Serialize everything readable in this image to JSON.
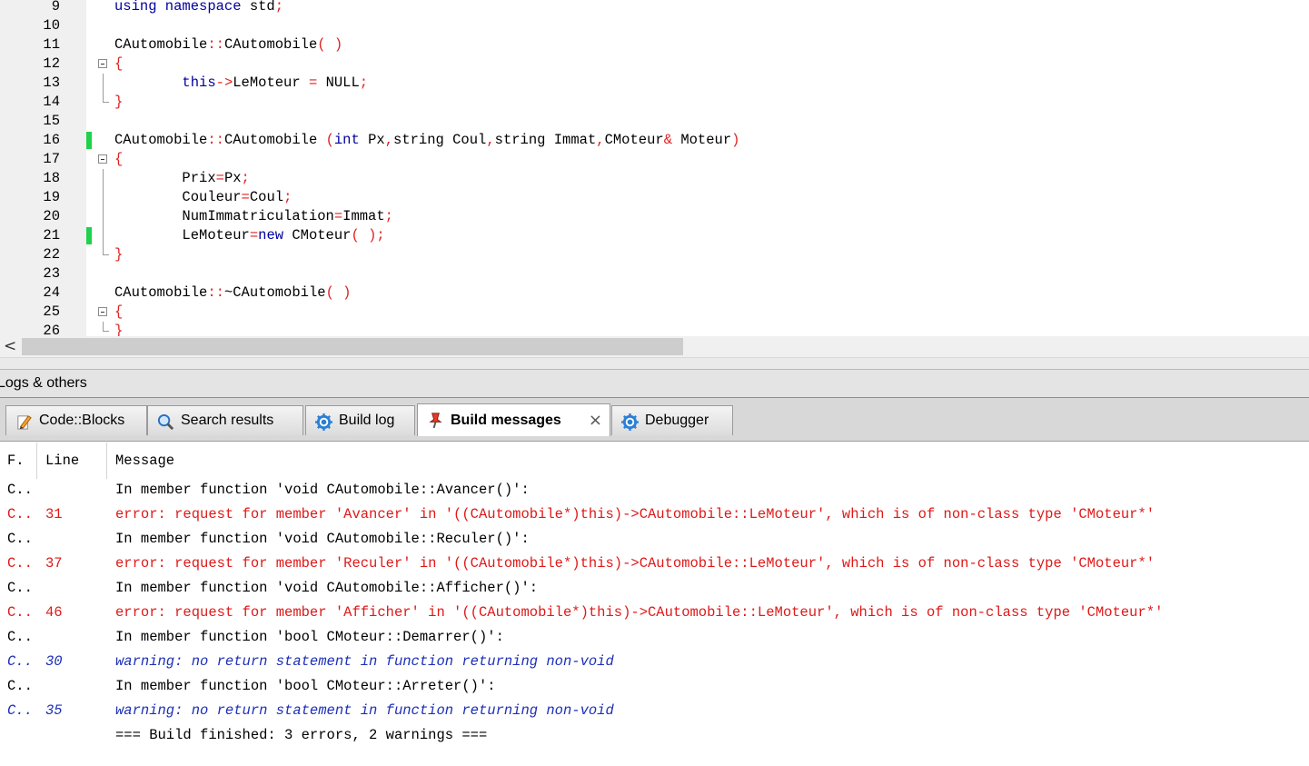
{
  "editor": {
    "lines": [
      {
        "n": "9",
        "segs": [
          {
            "t": "using namespace ",
            "c": "kw"
          },
          {
            "t": "std",
            "c": ""
          },
          {
            "t": ";",
            "c": "op"
          }
        ]
      },
      {
        "n": "10",
        "segs": []
      },
      {
        "n": "11",
        "segs": [
          {
            "t": "CAutomobile",
            "c": ""
          },
          {
            "t": "::",
            "c": "op"
          },
          {
            "t": "CAutomobile",
            "c": ""
          },
          {
            "t": "( )",
            "c": "op"
          }
        ]
      },
      {
        "n": "12",
        "fold": "open",
        "segs": [
          {
            "t": "{",
            "c": "op"
          }
        ]
      },
      {
        "n": "13",
        "fold": "line",
        "segs": [
          {
            "t": "        ",
            "c": ""
          },
          {
            "t": "this",
            "c": "kw"
          },
          {
            "t": "->",
            "c": "op"
          },
          {
            "t": "LeMoteur ",
            "c": ""
          },
          {
            "t": "=",
            "c": "op"
          },
          {
            "t": " NULL",
            "c": ""
          },
          {
            "t": ";",
            "c": "op"
          }
        ]
      },
      {
        "n": "14",
        "fold": "end",
        "segs": [
          {
            "t": "}",
            "c": "op"
          }
        ]
      },
      {
        "n": "15",
        "segs": []
      },
      {
        "n": "16",
        "changed": true,
        "segs": [
          {
            "t": "CAutomobile",
            "c": ""
          },
          {
            "t": "::",
            "c": "op"
          },
          {
            "t": "CAutomobile ",
            "c": ""
          },
          {
            "t": "(",
            "c": "op"
          },
          {
            "t": "int",
            "c": "kw"
          },
          {
            "t": " Px",
            "c": ""
          },
          {
            "t": ",",
            "c": "op"
          },
          {
            "t": "string Coul",
            "c": ""
          },
          {
            "t": ",",
            "c": "op"
          },
          {
            "t": "string Immat",
            "c": ""
          },
          {
            "t": ",",
            "c": "op"
          },
          {
            "t": "CMoteur",
            "c": ""
          },
          {
            "t": "&",
            "c": "op"
          },
          {
            "t": " Moteur",
            "c": ""
          },
          {
            "t": ")",
            "c": "op"
          }
        ]
      },
      {
        "n": "17",
        "fold": "open",
        "segs": [
          {
            "t": "{",
            "c": "op"
          }
        ]
      },
      {
        "n": "18",
        "fold": "line",
        "segs": [
          {
            "t": "        Prix",
            "c": ""
          },
          {
            "t": "=",
            "c": "op"
          },
          {
            "t": "Px",
            "c": ""
          },
          {
            "t": ";",
            "c": "op"
          }
        ]
      },
      {
        "n": "19",
        "fold": "line",
        "segs": [
          {
            "t": "        Couleur",
            "c": ""
          },
          {
            "t": "=",
            "c": "op"
          },
          {
            "t": "Coul",
            "c": ""
          },
          {
            "t": ";",
            "c": "op"
          }
        ]
      },
      {
        "n": "20",
        "fold": "line",
        "segs": [
          {
            "t": "        NumImmatriculation",
            "c": ""
          },
          {
            "t": "=",
            "c": "op"
          },
          {
            "t": "Immat",
            "c": ""
          },
          {
            "t": ";",
            "c": "op"
          }
        ]
      },
      {
        "n": "21",
        "fold": "line",
        "changed": true,
        "segs": [
          {
            "t": "        LeMoteur",
            "c": ""
          },
          {
            "t": "=",
            "c": "op"
          },
          {
            "t": "new",
            "c": "kw"
          },
          {
            "t": " CMoteur",
            "c": ""
          },
          {
            "t": "( );",
            "c": "op"
          }
        ]
      },
      {
        "n": "22",
        "fold": "end",
        "segs": [
          {
            "t": "}",
            "c": "op"
          }
        ]
      },
      {
        "n": "23",
        "segs": []
      },
      {
        "n": "24",
        "segs": [
          {
            "t": "CAutomobile",
            "c": ""
          },
          {
            "t": "::",
            "c": "op"
          },
          {
            "t": "~CAutomobile",
            "c": ""
          },
          {
            "t": "( )",
            "c": "op"
          }
        ]
      },
      {
        "n": "25",
        "fold": "open",
        "segs": [
          {
            "t": "{",
            "c": "op"
          }
        ]
      },
      {
        "n": "26",
        "fold": "end",
        "segs": [
          {
            "t": "}",
            "c": "op"
          }
        ]
      }
    ]
  },
  "scrollbar": {
    "left_arrow": "<"
  },
  "panel": {
    "title": "Logs & others"
  },
  "tabs": [
    {
      "label": "Code::Blocks",
      "icon": "pencil-icon"
    },
    {
      "label": "Search results",
      "icon": "magnifier-icon"
    },
    {
      "label": "Build log",
      "icon": "gear-icon"
    },
    {
      "label": "Build messages",
      "icon": "pin-icon",
      "active": true,
      "close": "×"
    },
    {
      "label": "Debugger",
      "icon": "gear-icon"
    }
  ],
  "messages": {
    "headers": {
      "file": "F.",
      "line": "Line",
      "message": "Message"
    },
    "rows": [
      {
        "file": "C..",
        "line": "",
        "type": "info",
        "message": "In member function 'void CAutomobile::Avancer()':"
      },
      {
        "file": "C..",
        "line": "31",
        "type": "err",
        "message": "error: request for member 'Avancer' in '((CAutomobile*)this)->CAutomobile::LeMoteur', which is of non-class type 'CMoteur*'"
      },
      {
        "file": "C..",
        "line": "",
        "type": "info",
        "message": "In member function 'void CAutomobile::Reculer()':"
      },
      {
        "file": "C..",
        "line": "37",
        "type": "err",
        "message": "error: request for member 'Reculer' in '((CAutomobile*)this)->CAutomobile::LeMoteur', which is of non-class type 'CMoteur*'"
      },
      {
        "file": "C..",
        "line": "",
        "type": "info",
        "message": "In member function 'void CAutomobile::Afficher()':"
      },
      {
        "file": "C..",
        "line": "46",
        "type": "err",
        "message": "error: request for member 'Afficher' in '((CAutomobile*)this)->CAutomobile::LeMoteur', which is of non-class type 'CMoteur*'"
      },
      {
        "file": "C..",
        "line": "",
        "type": "info",
        "message": "In member function 'bool CMoteur::Demarrer()':"
      },
      {
        "file": "C..",
        "line": "30",
        "type": "warn",
        "message": "warning: no return statement in function returning non-void"
      },
      {
        "file": "C..",
        "line": "",
        "type": "info",
        "message": "In member function 'bool CMoteur::Arreter()':"
      },
      {
        "file": "C..",
        "line": "35",
        "type": "warn",
        "message": "warning: no return statement in function returning non-void"
      },
      {
        "file": "",
        "line": "",
        "type": "info",
        "message": "=== Build finished: 3 errors, 2 warnings ==="
      }
    ]
  },
  "colors": {
    "keyword": "#0000a0",
    "operator": "#e02020",
    "error": "#e01818",
    "warning": "#1d2fb8",
    "change_marker": "#1fd14b"
  }
}
